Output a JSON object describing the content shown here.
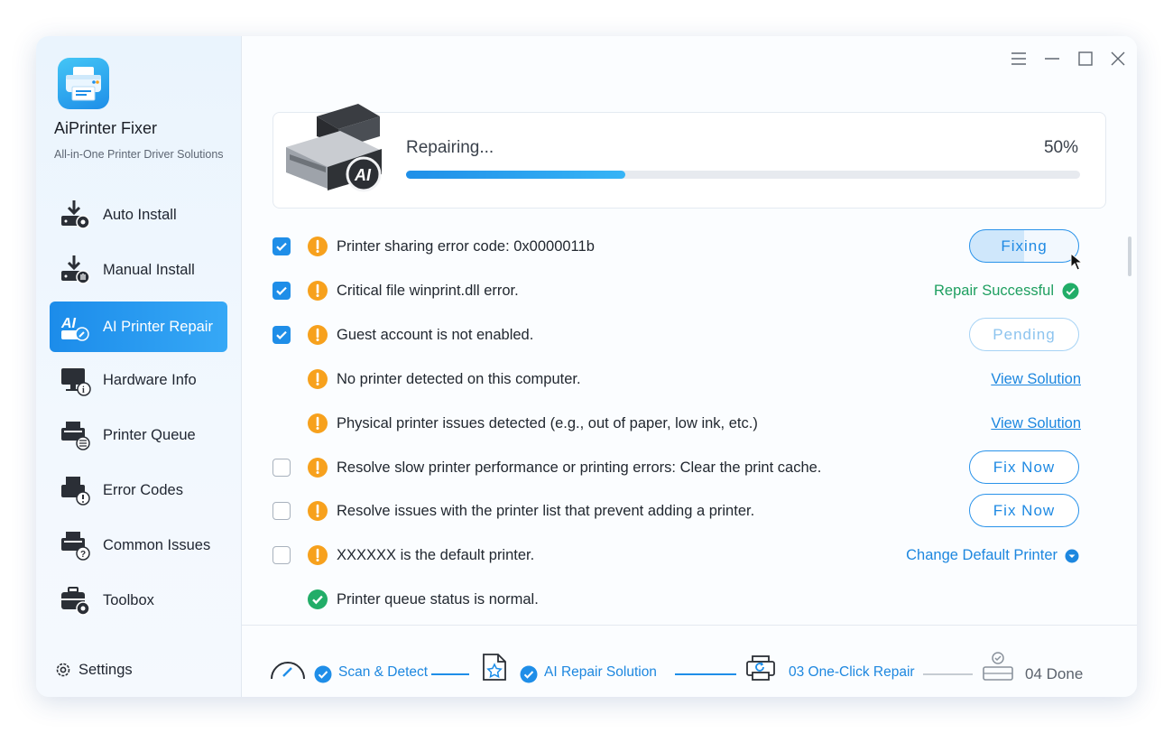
{
  "app": {
    "name": "AiPrinter Fixer",
    "subtitle": "All-in-One Printer Driver Solutions"
  },
  "sidebar": {
    "items": [
      {
        "label": "Auto Install",
        "icon": "auto-install-icon",
        "active": false
      },
      {
        "label": "Manual Install",
        "icon": "manual-install-icon",
        "active": false
      },
      {
        "label": "AI Printer Repair",
        "icon": "ai-repair-icon",
        "active": true
      },
      {
        "label": "Hardware Info",
        "icon": "hardware-info-icon",
        "active": false
      },
      {
        "label": "Printer Queue",
        "icon": "printer-queue-icon",
        "active": false
      },
      {
        "label": "Error Codes",
        "icon": "error-codes-icon",
        "active": false
      },
      {
        "label": "Common Issues",
        "icon": "common-issues-icon",
        "active": false
      },
      {
        "label": "Toolbox",
        "icon": "toolbox-icon",
        "active": false
      }
    ],
    "settings_label": "Settings"
  },
  "progress": {
    "label": "Repairing...",
    "percent_text": "50%",
    "value": 0.325
  },
  "issues": [
    {
      "checkbox": "checked",
      "status": "warning",
      "text": "Printer sharing error code: 0x0000011b",
      "action": "pill-fixing",
      "action_label": "Fixing"
    },
    {
      "checkbox": "checked",
      "status": "warning",
      "text": "Critical file winprint.dll error.",
      "action": "success",
      "action_label": "Repair Successful"
    },
    {
      "checkbox": "checked",
      "status": "warning",
      "text": "Guest account is not enabled.",
      "action": "pill-pending",
      "action_label": "Pending"
    },
    {
      "checkbox": "none",
      "status": "warning",
      "text": "No printer detected on this computer.",
      "action": "link",
      "action_label": "View Solution"
    },
    {
      "checkbox": "none",
      "status": "warning",
      "text": "Physical printer issues detected (e.g., out of paper, low ink, etc.)",
      "action": "link",
      "action_label": "View Solution"
    },
    {
      "checkbox": "unchecked",
      "status": "warning",
      "text": "Resolve slow printer performance or printing errors: Clear the print cache.",
      "action": "pill",
      "action_label": "Fix Now"
    },
    {
      "checkbox": "unchecked",
      "status": "warning",
      "text": "Resolve issues with the printer list that prevent adding a printer.",
      "action": "pill",
      "action_label": "Fix Now"
    },
    {
      "checkbox": "unchecked",
      "status": "warning",
      "text": "XXXXXX is the default printer.",
      "action": "dropdown",
      "action_label": "Change Default Printer"
    },
    {
      "checkbox": "none",
      "status": "ok",
      "text": "Printer queue status is normal.",
      "action": "none",
      "action_label": ""
    }
  ],
  "steps": [
    {
      "label": "Scan & Detect",
      "state": "done"
    },
    {
      "label": "AI Repair Solution",
      "state": "done"
    },
    {
      "label": "03 One-Click Repair",
      "state": "active"
    },
    {
      "label": "04 Done",
      "state": "pending"
    }
  ],
  "colors": {
    "accent": "#1f8ee8",
    "warning": "#f7a11d",
    "success": "#22ad68",
    "link": "#1d87df"
  }
}
